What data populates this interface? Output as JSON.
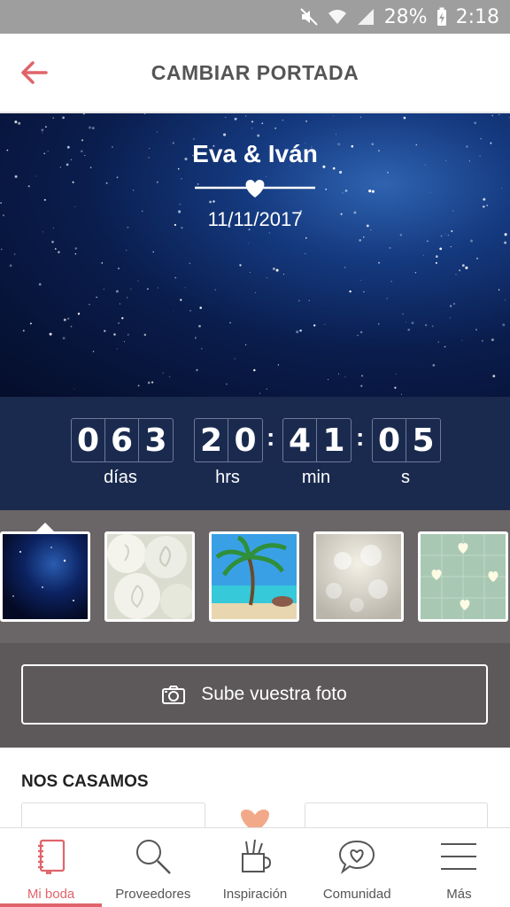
{
  "status_bar": {
    "battery": "28%",
    "time": "2:18"
  },
  "app_bar": {
    "title": "CAMBIAR PORTADA"
  },
  "cover": {
    "names": "Eva & Iván",
    "date": "11/11/2017"
  },
  "countdown": {
    "days": [
      "0",
      "6",
      "3"
    ],
    "hours": [
      "2",
      "0"
    ],
    "minutes": [
      "4",
      "1"
    ],
    "seconds": [
      "0",
      "5"
    ],
    "labels": {
      "days": "días",
      "hours": "hrs",
      "minutes": "min",
      "seconds": "s"
    }
  },
  "thumbnails": [
    "Cielo estrellado",
    "Rosas blancas",
    "Playa con palmera",
    "Corazones bokeh",
    "Corazones sobre tela verde"
  ],
  "upload": {
    "label": "Sube vuestra foto"
  },
  "section": {
    "title": "NOS CASAMOS"
  },
  "bottom_nav": {
    "items": [
      {
        "label": "Mi boda",
        "icon": "notebook-icon"
      },
      {
        "label": "Proveedores",
        "icon": "search-icon"
      },
      {
        "label": "Inspiración",
        "icon": "tools-cup-icon"
      },
      {
        "label": "Comunidad",
        "icon": "chat-heart-icon"
      },
      {
        "label": "Más",
        "icon": "menu-icon"
      }
    ]
  },
  "colors": {
    "accent": "#e0646a",
    "countdown_bg": "#1a2a4f",
    "strip_bg": "#6a6566",
    "upload_bg": "#5d5859"
  }
}
